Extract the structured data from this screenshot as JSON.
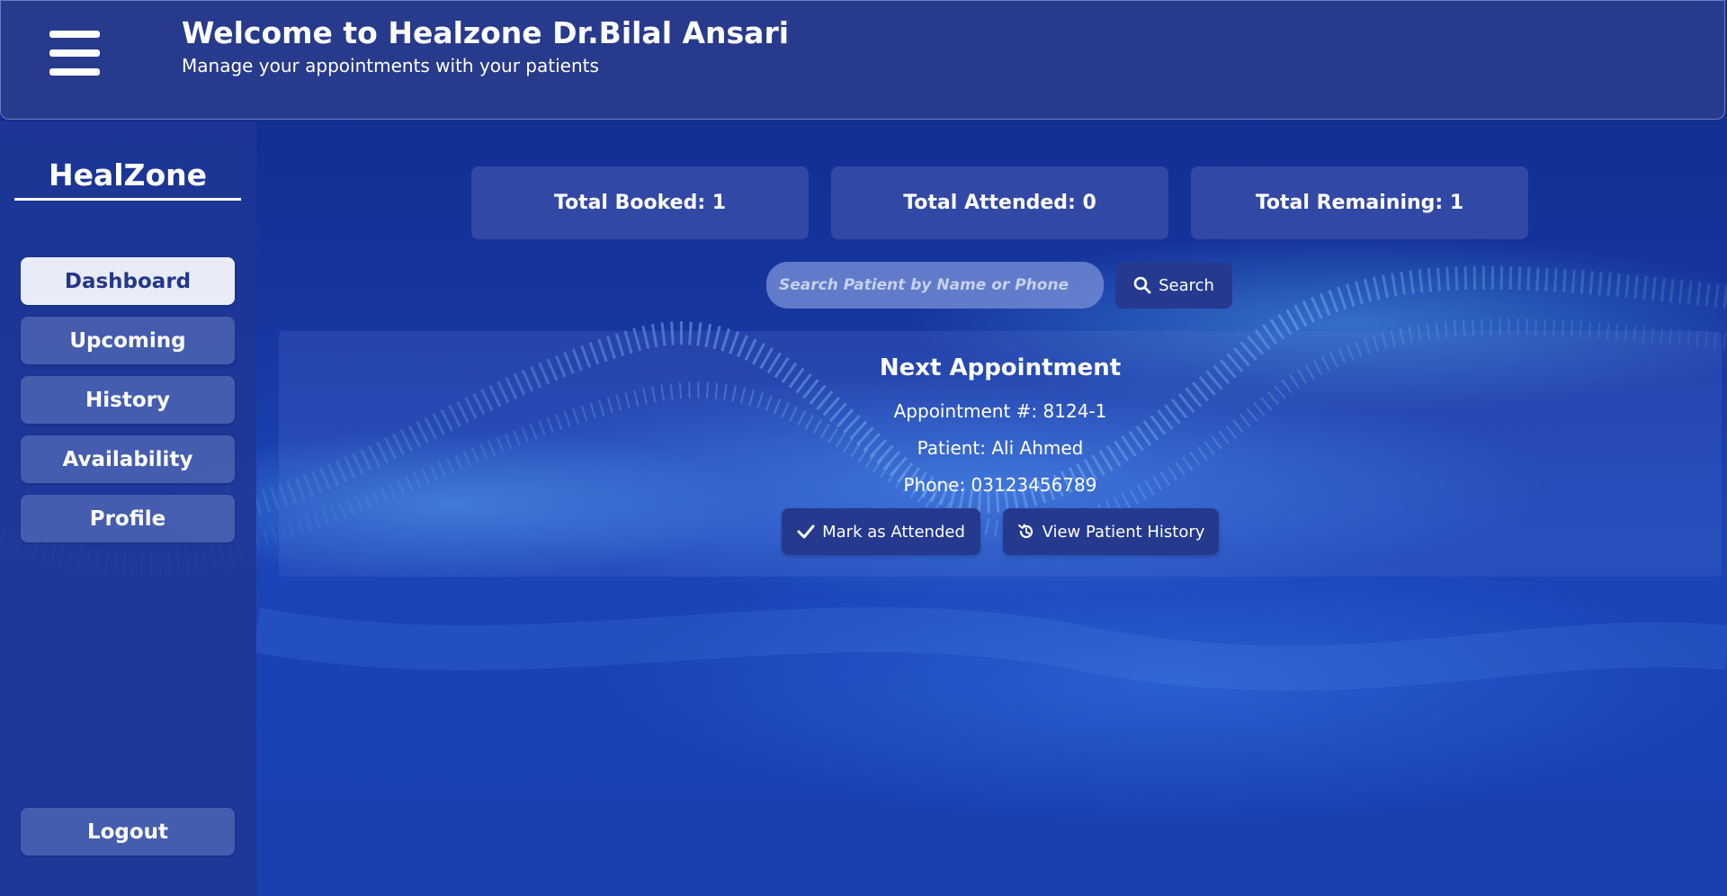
{
  "header": {
    "title": "Welcome to Healzone Dr.Bilal Ansari",
    "subtitle": "Manage your appointments with your patients",
    "menu_icon": "hamburger-menu-icon"
  },
  "sidebar": {
    "brand": "HealZone",
    "items": [
      {
        "label": "Dashboard",
        "active": true
      },
      {
        "label": "Upcoming",
        "active": false
      },
      {
        "label": "History",
        "active": false
      },
      {
        "label": "Availability",
        "active": false
      },
      {
        "label": "Profile",
        "active": false
      }
    ],
    "logout_label": "Logout"
  },
  "stats": {
    "booked": "Total Booked: 1",
    "attended": "Total Attended: 0",
    "remaining": "Total Remaining: 1"
  },
  "search": {
    "placeholder": "Search Patient by Name or Phone",
    "value": "",
    "button_label": "Search",
    "icon": "search-icon"
  },
  "appointment": {
    "title": "Next Appointment",
    "number": "Appointment #: 8124-1",
    "patient": "Patient: Ali Ahmed",
    "phone": "Phone: 03123456789",
    "mark_attended_label": "Mark as Attended",
    "view_history_label": "View Patient History"
  },
  "colors": {
    "background": "#1a3aa8",
    "header": "#2a3c8c",
    "active_nav": "#e9ecf7",
    "button_dark": "#25398e"
  }
}
